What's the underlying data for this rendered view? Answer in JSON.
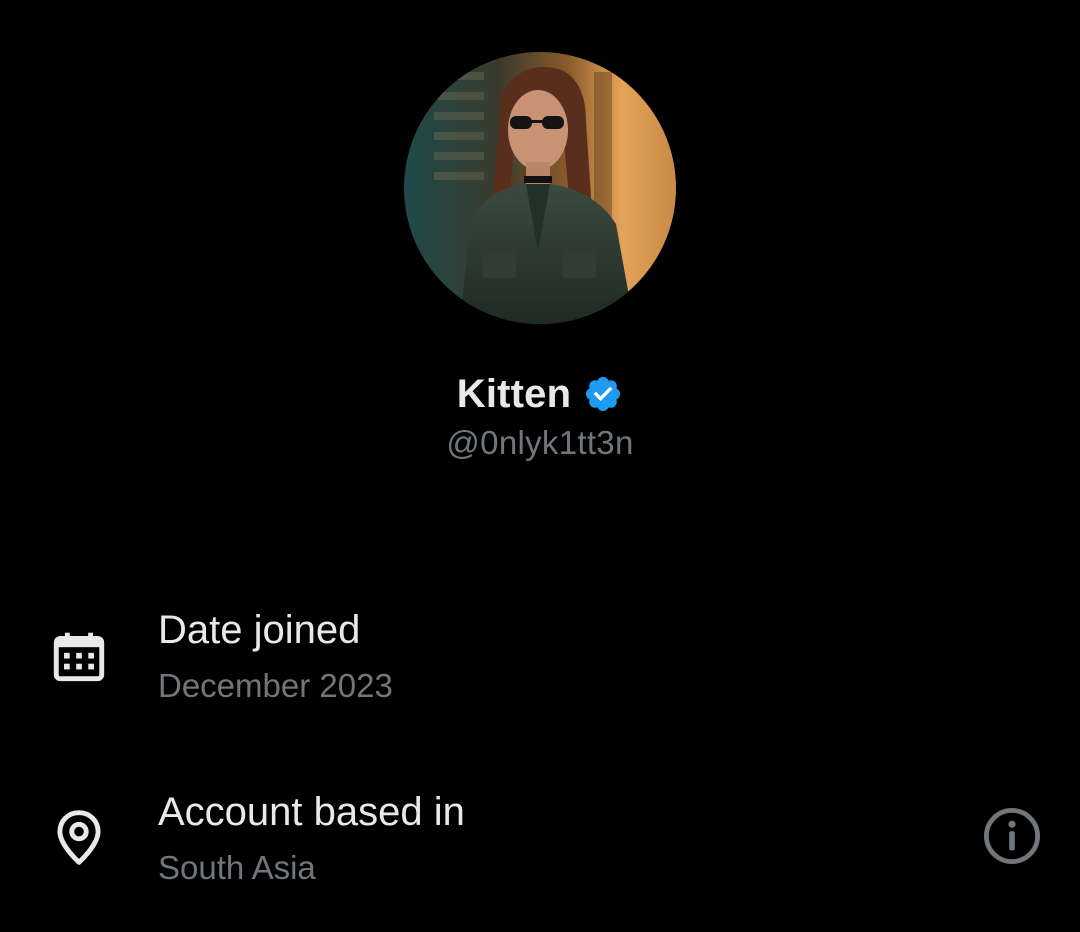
{
  "profile": {
    "display_name": "Kitten",
    "handle": "@0nlyk1tt3n",
    "verified": true,
    "verified_badge_color": "#1d9bf0",
    "avatar_icon": "profile-photo"
  },
  "about": {
    "date_joined": {
      "icon": "calendar-icon",
      "label": "Date joined",
      "value": "December 2023"
    },
    "account_based_in": {
      "icon": "location-pin-icon",
      "label": "Account based in",
      "value": "South Asia",
      "action_icon": "info-icon"
    }
  },
  "colors": {
    "background": "#000000",
    "primary_text": "#e7e9ea",
    "secondary_text": "#71767b",
    "icon": "#e7e9ea"
  }
}
